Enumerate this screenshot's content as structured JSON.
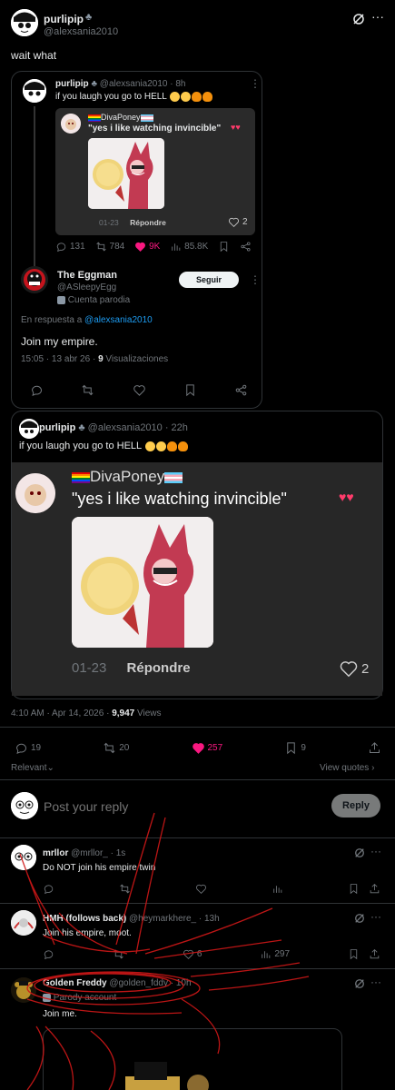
{
  "main_post": {
    "display_name": "purlipip",
    "handle": "@alexsania2010",
    "text": "wait what"
  },
  "quoted_thread": {
    "name": "purlipip",
    "handle_time": "@alexsania2010 · 8h",
    "text": "if you laugh you go to HELL",
    "inner_quote": {
      "name": "DivaPoney",
      "text": "\"yes i like watching invincible\"",
      "date": "01-23",
      "reply_label": "Répondre",
      "likes": "2"
    },
    "stats": {
      "replies": "131",
      "reposts": "784",
      "likes": "9K",
      "views": "85.8K"
    }
  },
  "eggman_reply": {
    "name": "The Eggman",
    "handle": "@ASleepyEgg",
    "label": "Cuenta parodia",
    "follow_label": "Seguir",
    "in_reply_prefix": "En respuesta a",
    "in_reply_handle": "@alexsania2010",
    "text": "Join my empire.",
    "time": "15:05 · 13 abr 26 ·",
    "views_count": "9",
    "views_label": "Visualizaciones"
  },
  "second_quote": {
    "name": "purlipip",
    "handle_time": "@alexsania2010 · 22h",
    "text": "if you laugh you go to HELL",
    "inner_quote": {
      "name": "DivaPoney",
      "text": "\"yes i like watching invincible\"",
      "date": "01-23",
      "reply_label": "Répondre",
      "likes": "2"
    }
  },
  "post_meta": {
    "time": "4:10 AM · Apr 14, 2026 ·",
    "views": "9,947",
    "views_label": "Views"
  },
  "post_stats": {
    "replies": "19",
    "reposts": "20",
    "likes": "257",
    "bookmarks": "9"
  },
  "sort": {
    "relevant": "Relevant",
    "view_quotes": "View quotes"
  },
  "compose": {
    "placeholder": "Post your reply",
    "reply_button": "Reply"
  },
  "replies": [
    {
      "name": "mrllor",
      "handle_time": "@mrllor_ · 1s",
      "text": "Do NOT join his empire twin"
    },
    {
      "name": "HMH (follows back)",
      "handle_time": "@heymarkhere_ · 13h",
      "text": "Join his empire, moot.",
      "likes": "6",
      "views": "297"
    },
    {
      "name": "Golden Freddy",
      "handle_time": "@golden_fddy · 10h",
      "label": "Parody account",
      "text": "Join me."
    }
  ],
  "colors": {
    "like_pink": "#f91880",
    "link_blue": "#1d9bf0",
    "bg": "#000000",
    "border": "#2f3336",
    "scribble_red": "#d01818"
  }
}
